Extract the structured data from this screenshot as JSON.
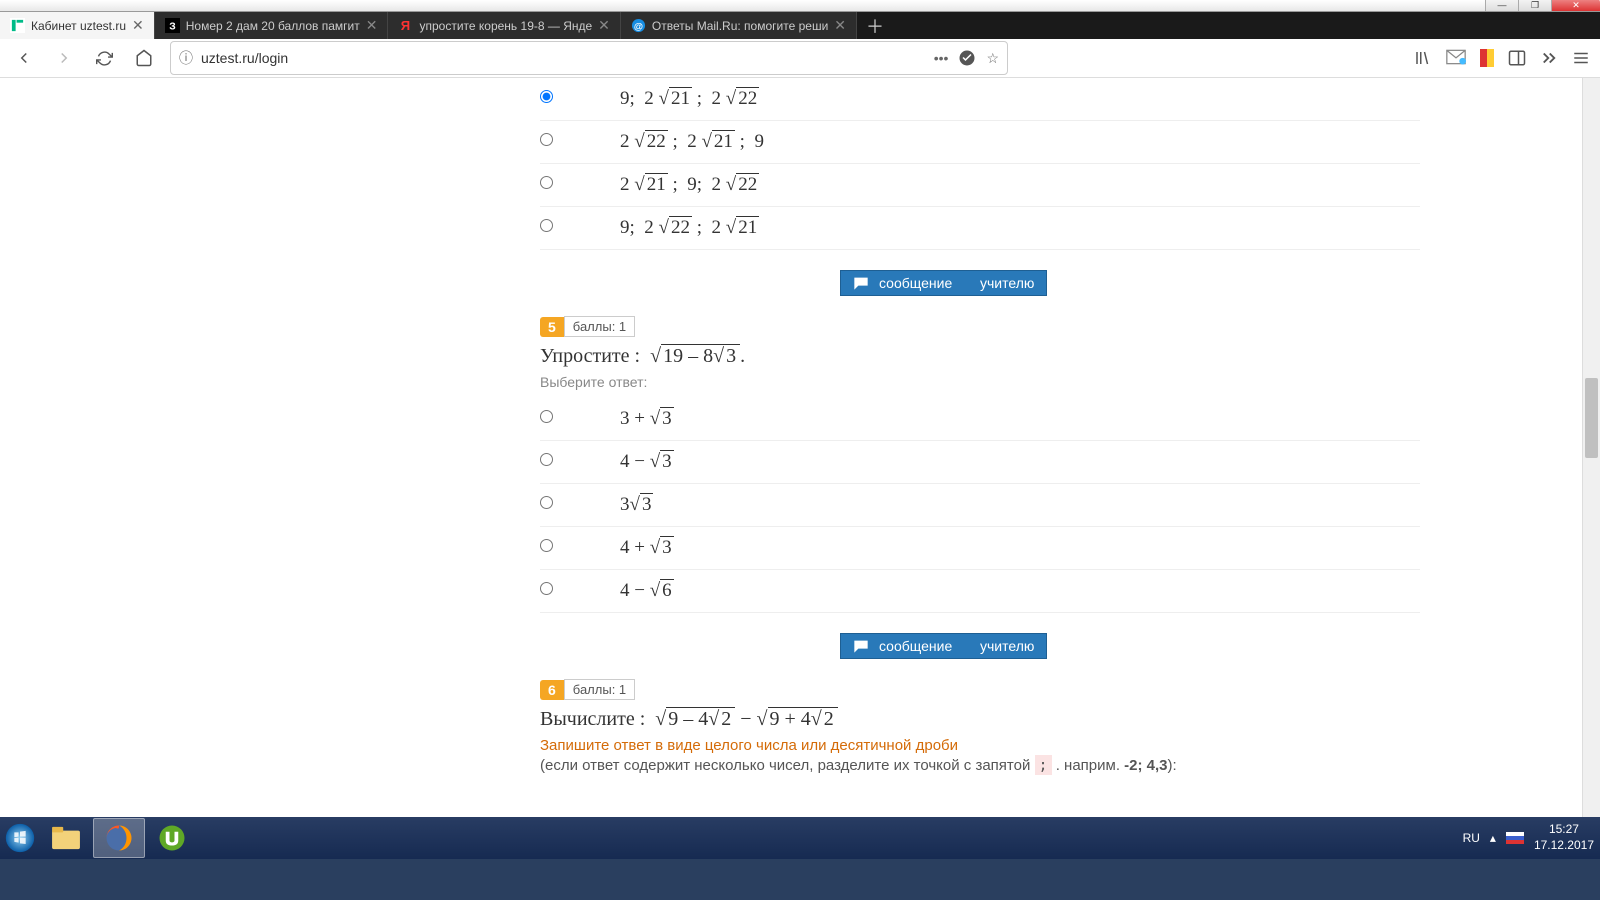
{
  "window": {
    "min": "—",
    "max": "❐",
    "close": "✕"
  },
  "tabs": [
    {
      "icon": "uztest",
      "label": "Кабинет uztest.ru",
      "active": true
    },
    {
      "icon": "z",
      "label": "Номер 2 дам 20 баллов памгит"
    },
    {
      "icon": "ya",
      "label": "упростите корень 19-8 — Янде"
    },
    {
      "icon": "mail",
      "label": "Ответы Mail.Ru: помогите реши"
    }
  ],
  "url": "uztest.ru/login",
  "q4": {
    "options": [
      {
        "sel": true,
        "a": "9",
        "b": "21",
        "c": "22",
        "pattern": "abc"
      },
      {
        "sel": false,
        "a": "22",
        "b": "21",
        "c": "9",
        "pattern": "ab_c"
      },
      {
        "sel": false,
        "a": "21",
        "b": "9",
        "c": "22",
        "pattern": "a_bc"
      },
      {
        "sel": false,
        "a": "9",
        "b": "22",
        "c": "21",
        "pattern": "abc"
      }
    ]
  },
  "msg_btn": {
    "a": "сообщение",
    "b": "учителю"
  },
  "q5": {
    "num": "5",
    "pts": "баллы: 1",
    "title_prefix": "Упростите :",
    "root_outer": "19 – 8",
    "root_inner": "3",
    "period": ".",
    "sub": "Выберите ответ:",
    "options": [
      {
        "txt": "3 + √3"
      },
      {
        "txt": "4 − √3"
      },
      {
        "txt": "3√3"
      },
      {
        "txt": "4 + √3"
      },
      {
        "txt": "4 − √6"
      }
    ]
  },
  "q6": {
    "num": "6",
    "pts": "баллы: 1",
    "title_prefix": "Вычислите :",
    "r1": "9 – 4",
    "r1i": "2",
    "minus": " − ",
    "r2": "9 + 4",
    "r2i": "2",
    "hint": "Запишите ответ в виде целого числа или десятичной дроби",
    "hint2_a": "(если ответ содержит несколько чисел, разделите их точкой с запятой ",
    "hint2_semi": ";",
    "hint2_b": " . наприм. ",
    "hint2_ex": "-2; 4,3",
    "hint2_c": "):"
  },
  "tray": {
    "lang": "RU",
    "time": "15:27",
    "date": "17.12.2017"
  }
}
